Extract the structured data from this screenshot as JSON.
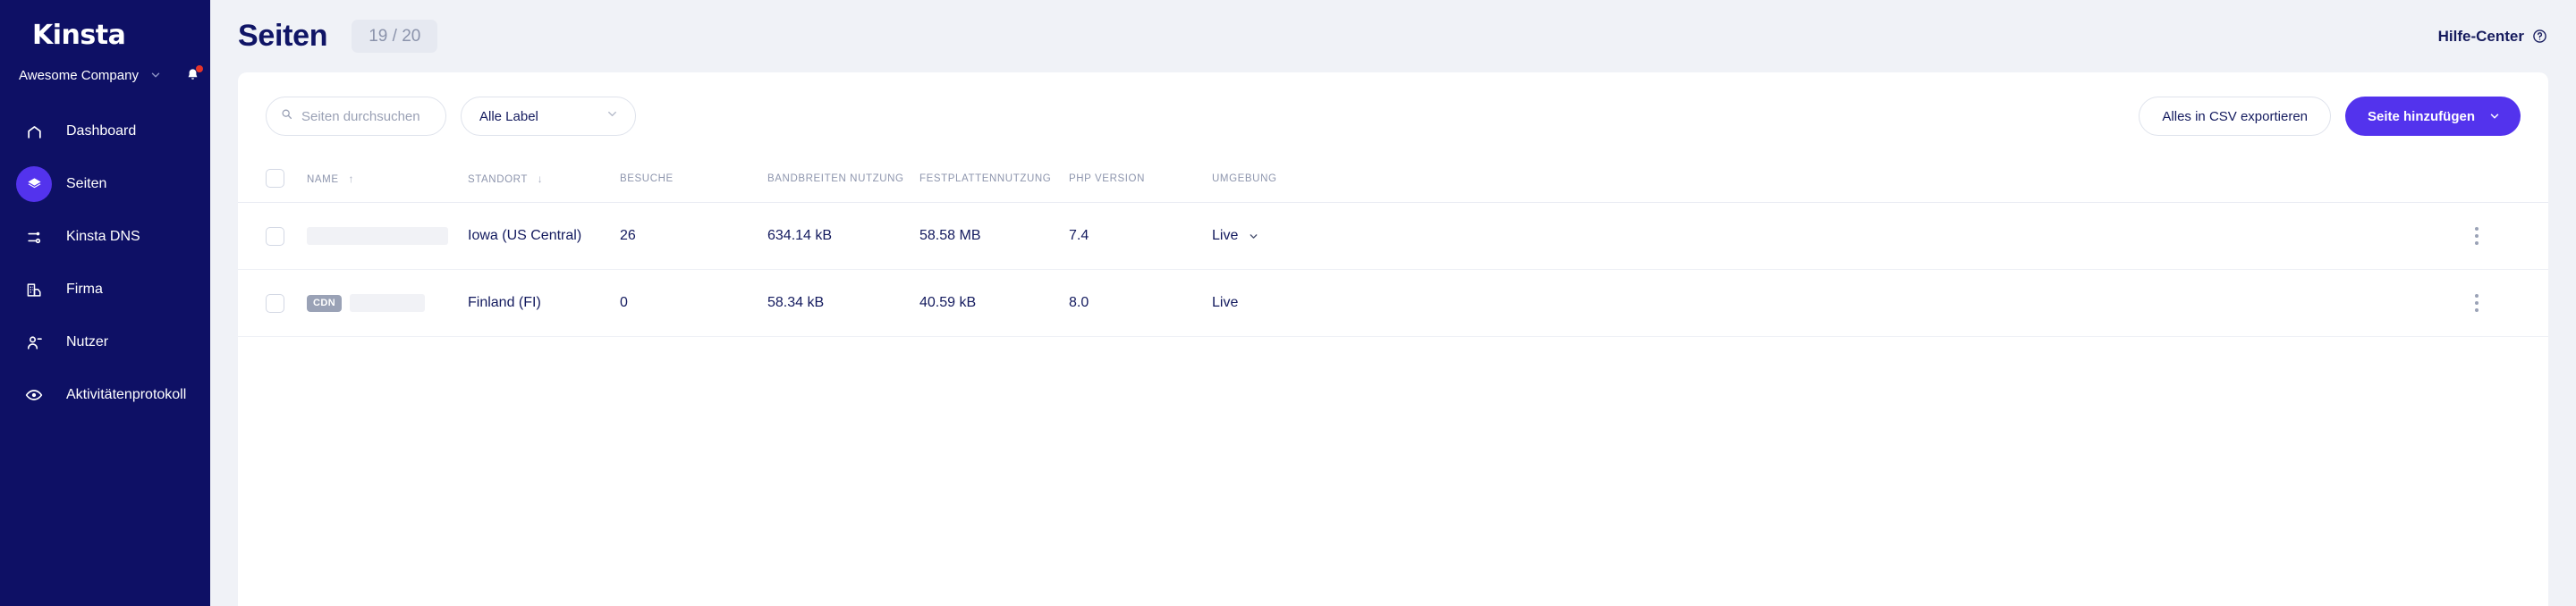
{
  "sidebar": {
    "logo": "Kinsta",
    "company": {
      "name": "Awesome Company",
      "chevron_icon": "chevron-down-icon"
    },
    "notifications": {
      "icon": "bell-icon",
      "has_unread": true,
      "dot_color": "#e5342a"
    },
    "items": [
      {
        "label": "Dashboard",
        "icon": "home-icon",
        "active": false
      },
      {
        "label": "Seiten",
        "icon": "layers-icon",
        "active": true
      },
      {
        "label": "Kinsta DNS",
        "icon": "dns-network-icon",
        "active": false
      },
      {
        "label": "Firma",
        "icon": "building-icon",
        "active": false
      },
      {
        "label": "Nutzer",
        "icon": "user-add-icon",
        "active": false
      },
      {
        "label": "Aktivitätenprotokoll",
        "icon": "eye-icon",
        "active": false
      }
    ],
    "bg_color": "#0e1065",
    "active_color": "#5333ed"
  },
  "header": {
    "title": "Seiten",
    "count_badge": "19 / 20",
    "help_center": {
      "label": "Hilfe-Center",
      "icon": "question-circle-icon"
    }
  },
  "toolbar": {
    "search": {
      "placeholder": "Seiten durchsuchen",
      "value": "",
      "icon": "search-icon"
    },
    "label_filter": {
      "value": "Alle Label",
      "icon": "chevron-down-icon"
    },
    "export_button": "Alles in CSV exportieren",
    "add_site_button": {
      "label": "Seite hinzufügen",
      "icon": "chevron-down-icon",
      "color": "#5333ed"
    }
  },
  "table": {
    "columns": [
      {
        "key": "check",
        "label": ""
      },
      {
        "key": "name",
        "label": "NAME",
        "sort": "asc",
        "sort_icon": "arrow-up-icon"
      },
      {
        "key": "location",
        "label": "STANDORT",
        "sort": "desc",
        "sort_icon": "arrow-down-icon"
      },
      {
        "key": "visits",
        "label": "BESUCHE"
      },
      {
        "key": "bandwidth",
        "label": "BANDBREITEN NUTZUNG"
      },
      {
        "key": "disk",
        "label": "FESTPLATTENNUTZUNG"
      },
      {
        "key": "php",
        "label": "PHP VERSION"
      },
      {
        "key": "env",
        "label": "UMGEBUNG"
      }
    ],
    "rows": [
      {
        "selected": false,
        "cdn_badge": null,
        "name_redacted": true,
        "name_width": "w1",
        "location": "Iowa (US Central)",
        "visits": "26",
        "bandwidth": "634.14 kB",
        "disk": "58.58 MB",
        "php": "7.4",
        "env": "Live",
        "env_has_chevron": true,
        "menu_icon": "kebab-menu-icon"
      },
      {
        "selected": false,
        "cdn_badge": "CDN",
        "name_redacted": true,
        "name_width": "w2",
        "location": "Finland (FI)",
        "visits": "0",
        "bandwidth": "58.34 kB",
        "disk": "40.59 kB",
        "php": "8.0",
        "env": "Live",
        "env_has_chevron": false,
        "menu_icon": "kebab-menu-icon"
      }
    ]
  }
}
